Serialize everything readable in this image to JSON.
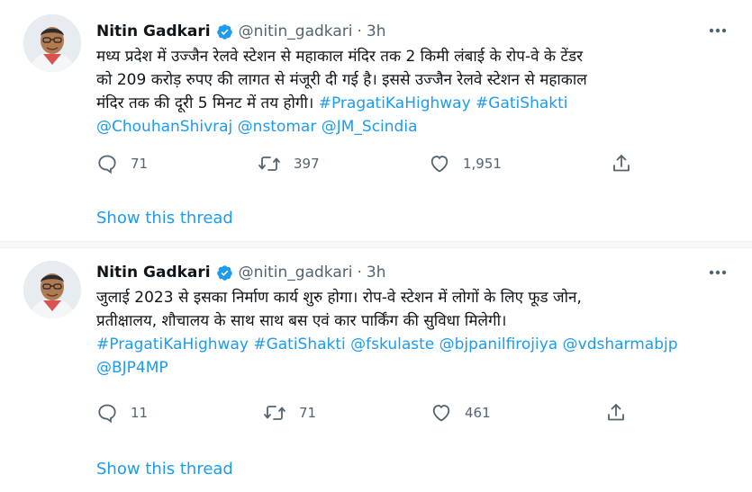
{
  "tweets": [
    {
      "author": {
        "name": "Nitin Gadkari",
        "handle": "@nitin_gadkari",
        "time": "3h",
        "separator": "·"
      },
      "text_lines": [
        "मध्य प्रदेश में उज्जैन रेलवे स्टेशन से महाकाल मंदिर तक 2 किमी लंबाई के रोप-वे के टेंडर",
        "को 209 करोड़ रुपए की लागत से मंजूरी दी गई है। इससे उज्जैन रेलवे स्टेशन से महाकाल",
        "मंदिर तक की दूरी 5 मिनट में तय होगी।"
      ],
      "inline_tags": "#PragatiKaHighway #GatiShakti",
      "mention_line": "@ChouhanShivraj @nstomar @JM_Scindia",
      "stats": {
        "replies": "71",
        "retweets": "397",
        "likes": "1,951"
      },
      "show_thread": "Show this thread"
    },
    {
      "author": {
        "name": "Nitin Gadkari",
        "handle": "@nitin_gadkari",
        "time": "3h",
        "separator": "·"
      },
      "text_lines": [
        "जुलाई 2023 से इसका निर्माण कार्य शुरु होगा। रोप-वे स्टेशन में लोगों के लिए फूड जोन,",
        "प्रतीक्षालय, शौचालय के साथ साथ बस एवं कार पार्किंग की सुविधा मिलेगी।"
      ],
      "tag_line": "#PragatiKaHighway #GatiShakti @fskulaste @bjpanilfirojiya @vdsharmabjp",
      "tag_line2": "@BJP4MP",
      "stats": {
        "replies": "11",
        "retweets": "71",
        "likes": "461"
      },
      "show_thread": "Show this thread"
    }
  ],
  "icons": {
    "verified": "verified-badge-icon",
    "more": "more-options-icon",
    "reply": "reply-icon",
    "retweet": "retweet-icon",
    "like": "like-icon",
    "share": "share-icon"
  },
  "colors": {
    "link": "#1d9bf0",
    "text": "#0f1419",
    "secondary": "#536471"
  }
}
